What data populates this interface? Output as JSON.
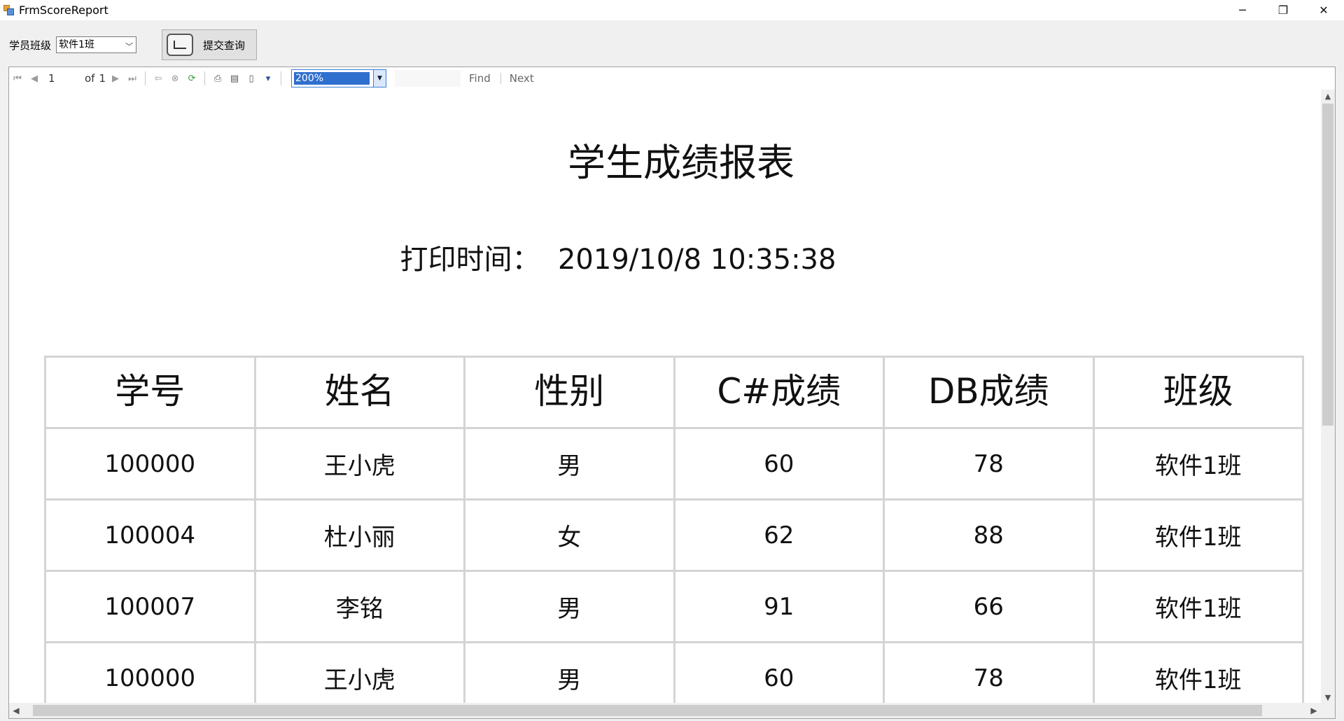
{
  "window": {
    "title": "FrmScoreReport",
    "controls": {
      "minimize": "─",
      "restore": "❐",
      "close": "✕"
    }
  },
  "criteria": {
    "class_label": "学员班级",
    "class_value": "软件1班",
    "submit_label": "提交查询"
  },
  "toolbar": {
    "page_current": "1",
    "of_label": "of",
    "page_total": "1",
    "zoom": "200%",
    "find_label": "Find",
    "next_label": "Next"
  },
  "report": {
    "title": "学生成绩报表",
    "print_label": "打印时间：",
    "print_time": "2019/10/8 10:35:38",
    "columns": [
      "学号",
      "姓名",
      "性别",
      "C#成绩",
      "DB成绩",
      "班级"
    ],
    "rows": [
      [
        "100000",
        "王小虎",
        "男",
        "60",
        "78",
        "软件1班"
      ],
      [
        "100004",
        "杜小丽",
        "女",
        "62",
        "88",
        "软件1班"
      ],
      [
        "100007",
        "李铭",
        "男",
        "91",
        "66",
        "软件1班"
      ],
      [
        "100000",
        "王小虎",
        "男",
        "60",
        "78",
        "软件1班"
      ]
    ]
  }
}
